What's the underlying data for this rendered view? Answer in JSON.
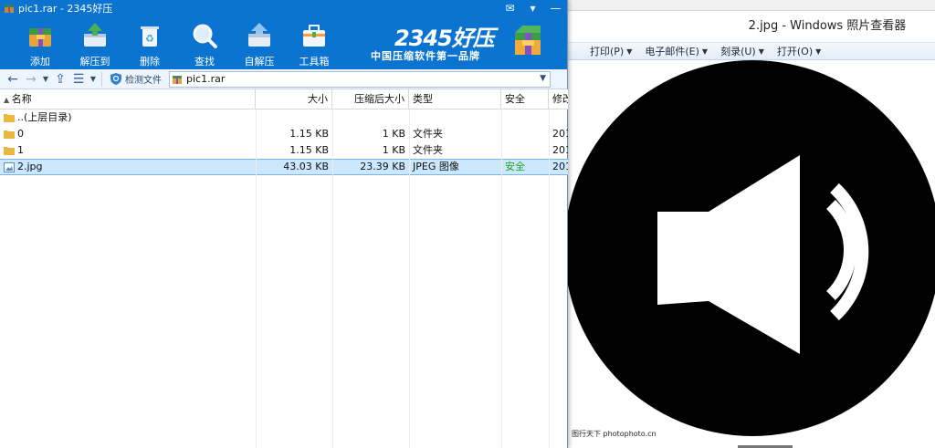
{
  "app": {
    "title": "pic1.rar - 2345好压",
    "toolbar": [
      {
        "label": "添加",
        "icon": "add-archive-icon"
      },
      {
        "label": "解压到",
        "icon": "extract-to-icon"
      },
      {
        "label": "删除",
        "icon": "delete-icon"
      },
      {
        "label": "查找",
        "icon": "search-icon"
      },
      {
        "label": "自解压",
        "icon": "self-extract-icon"
      },
      {
        "label": "工具箱",
        "icon": "toolbox-icon"
      }
    ],
    "brand": {
      "logo": "2345好压",
      "slogan": "中国压缩软件第一品牌"
    },
    "address": {
      "scan_label": "检测文件",
      "path": "pic1.rar"
    },
    "columns": {
      "name": "名称",
      "size": "大小",
      "csize": "压缩后大小",
      "type": "类型",
      "safe": "安全",
      "modified": "修改"
    },
    "rows": [
      {
        "name": "..(上层目录)",
        "size": "",
        "csize": "",
        "type": "",
        "safe": "",
        "modified": "",
        "icon": "folder-up-icon"
      },
      {
        "name": "0",
        "size": "1.15 KB",
        "csize": "1 KB",
        "type": "文件夹",
        "safe": "",
        "modified": "201",
        "icon": "folder-icon"
      },
      {
        "name": "1",
        "size": "1.15 KB",
        "csize": "1 KB",
        "type": "文件夹",
        "safe": "",
        "modified": "201",
        "icon": "folder-icon"
      },
      {
        "name": "2.jpg",
        "size": "43.03 KB",
        "csize": "23.39 KB",
        "type": "JPEG 图像",
        "safe": "安全",
        "modified": "201",
        "icon": "image-file-icon",
        "selected": true
      }
    ],
    "colors": {
      "titlebar": "#0b74d1",
      "safe": "#20a020",
      "selection": "#cce8ff"
    }
  },
  "viewer": {
    "title": "2.jpg - Windows 照片查看器",
    "menu": [
      {
        "label": "打印(P)"
      },
      {
        "label": "电子邮件(E)"
      },
      {
        "label": "刻录(U)"
      },
      {
        "label": "打开(O)"
      }
    ],
    "watermark": "图行天下 photophoto.cn",
    "image_subject": "speaker-volume-icon"
  }
}
